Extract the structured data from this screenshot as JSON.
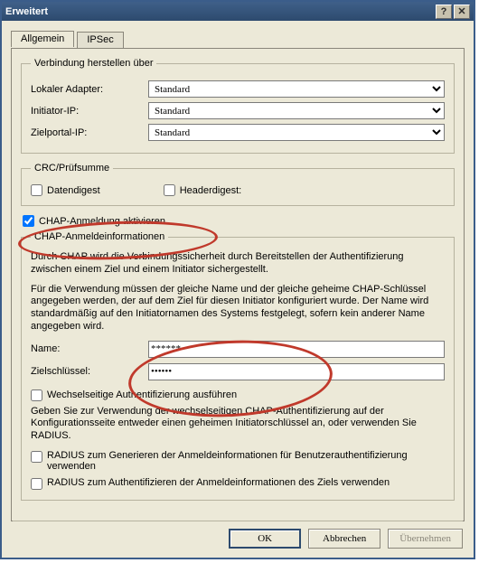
{
  "title": "Erweitert",
  "tabs": {
    "general": "Allgemein",
    "ipsec": "IPSec"
  },
  "conn": {
    "legend": "Verbindung herstellen über",
    "adapter_label": "Lokaler Adapter:",
    "adapter_value": "Standard",
    "initiator_label": "Initiator-IP:",
    "initiator_value": "Standard",
    "portal_label": "Zielportal-IP:",
    "portal_value": "Standard"
  },
  "crc": {
    "legend": "CRC/Prüfsumme",
    "data": "Datendigest",
    "header": "Headerdigest:"
  },
  "chap": {
    "enable": "CHAP-Anmeldung aktivieren",
    "legend": "CHAP-Anmeldeinformationen",
    "para1": "Durch CHAP wird die Verbindungssicherheit durch Bereitstellen der Authentifizierung zwischen einem Ziel und einem Initiator sichergestellt.",
    "para2": "Für die Verwendung müssen der gleiche Name und der gleiche geheime CHAP-Schlüssel angegeben werden, der auf dem Ziel für diesen Initiator konfiguriert wurde. Der Name wird standardmäßig auf den Initiatornamen des Systems festgelegt, sofern kein anderer Name angegeben wird.",
    "name_label": "Name:",
    "name_value": "******",
    "secret_label": "Zielschlüssel:",
    "secret_value": "••••••",
    "mutual": "Wechselseitige Authentifizierung ausführen",
    "mutual_note": "Geben Sie zur Verwendung der wechselseitigen CHAP-Authentifizierung auf der Konfigurationsseite entweder einen geheimen Initiatorschlüssel an, oder verwenden Sie RADIUS.",
    "radius1": "RADIUS zum Generieren der Anmeldeinformationen für Benutzerauthentifizierung verwenden",
    "radius2": "RADIUS zum Authentifizieren der Anmeldeinformationen des Ziels verwenden"
  },
  "buttons": {
    "ok": "OK",
    "cancel": "Abbrechen",
    "apply": "Übernehmen"
  }
}
